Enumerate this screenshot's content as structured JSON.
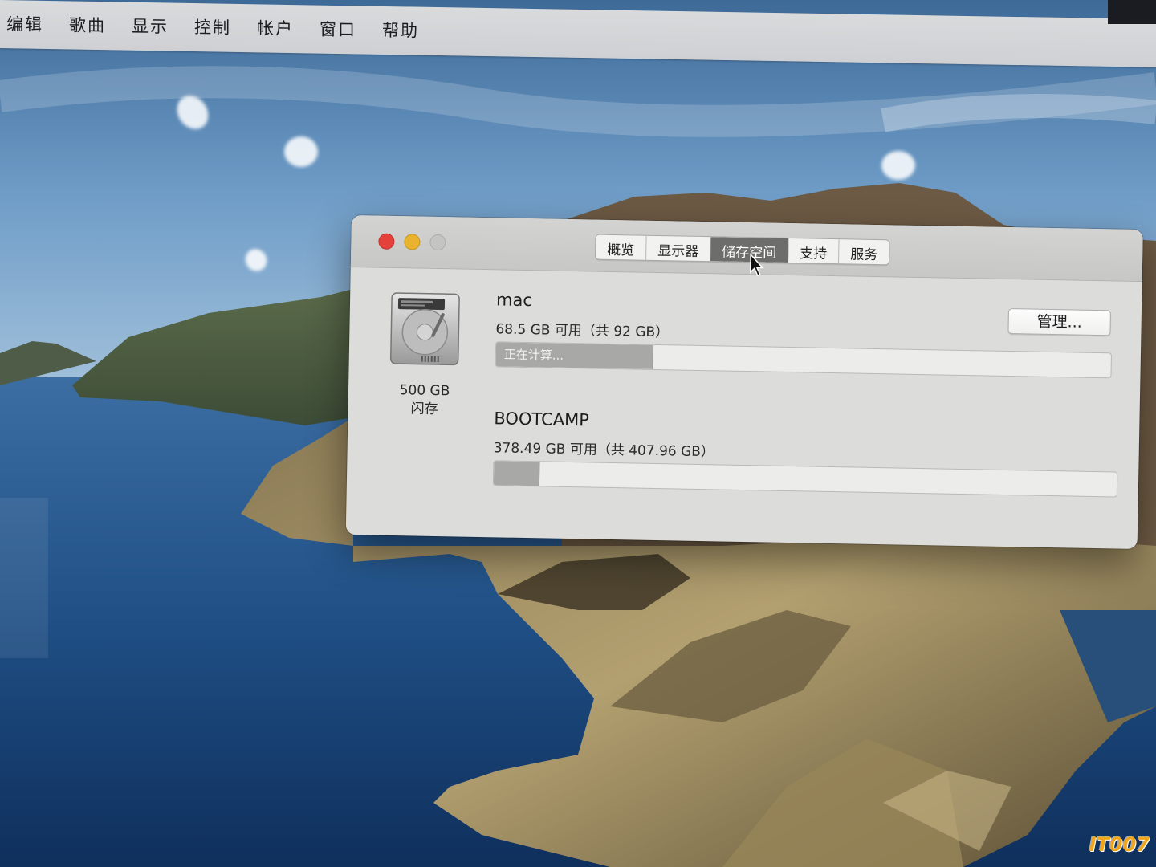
{
  "menubar": {
    "items": [
      "编辑",
      "歌曲",
      "显示",
      "控制",
      "帐户",
      "窗口",
      "帮助"
    ]
  },
  "window": {
    "tabs": [
      {
        "label": "概览",
        "active": false
      },
      {
        "label": "显示器",
        "active": false
      },
      {
        "label": "储存空间",
        "active": true
      },
      {
        "label": "支持",
        "active": false
      },
      {
        "label": "服务",
        "active": false
      }
    ],
    "drive": {
      "icon": "hard-drive-icon",
      "capacity": "500 GB",
      "type": "闪存"
    },
    "volumes": [
      {
        "name": "mac",
        "info": "68.5 GB 可用（共 92 GB）",
        "bar_label": "正在计算...",
        "used_fraction": 0.255
      },
      {
        "name": "BOOTCAMP",
        "info": "378.49 GB 可用（共 407.96 GB）",
        "bar_label": "",
        "used_fraction": 0.072
      }
    ],
    "manage_button": "管理..."
  },
  "watermark": "IT007",
  "colors": {
    "close": "#e5413b",
    "minimize": "#e9b22f",
    "active_tab": "#6d6d6c",
    "watermark": "#f2a518"
  }
}
